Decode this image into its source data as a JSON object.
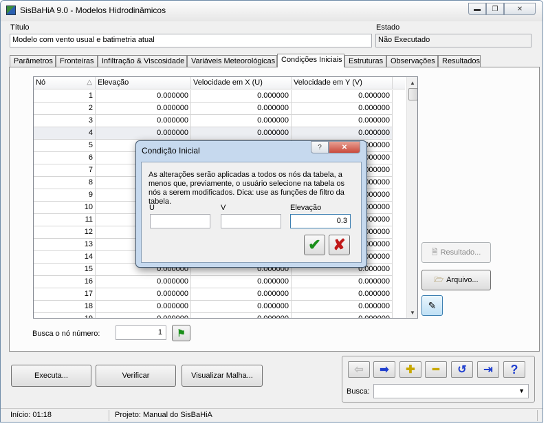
{
  "window": {
    "title": "SisBaHiA 9.0 - Modelos Hidrodinâmicos"
  },
  "colors": {
    "accent_blue": "#1f3fcf",
    "ok_green": "#1a8f1a",
    "cancel_red": "#c01818",
    "close_red": "#c94a3c"
  },
  "header": {
    "titulo_label": "Título",
    "titulo_value": "Modelo com vento usual e batimetria atual",
    "estado_label": "Estado",
    "estado_value": "Não Executado"
  },
  "tabs": [
    {
      "label": "Parâmetros"
    },
    {
      "label": "Fronteiras"
    },
    {
      "label": "Infiltração & Viscosidade"
    },
    {
      "label": "Variáveis Meteorológicas"
    },
    {
      "label": "Condições Iniciais",
      "active": true
    },
    {
      "label": "Estruturas"
    },
    {
      "label": "Observações"
    },
    {
      "label": "Resultados"
    }
  ],
  "grid": {
    "columns": [
      "Nó",
      "Elevação",
      "Velocidade em X (U)",
      "Velocidade em Y (V)"
    ],
    "sort_indicator": "△",
    "rows": [
      [
        "1",
        "0.000000",
        "0.000000",
        "0.000000"
      ],
      [
        "2",
        "0.000000",
        "0.000000",
        "0.000000"
      ],
      [
        "3",
        "0.000000",
        "0.000000",
        "0.000000"
      ],
      [
        "4",
        "0.000000",
        "0.000000",
        "0.000000"
      ],
      [
        "5",
        "0.000000",
        "0.000000",
        "0.000000"
      ],
      [
        "6",
        "0.000000",
        "0.000000",
        "0.000000"
      ],
      [
        "7",
        "0.000000",
        "0.000000",
        "0.000000"
      ],
      [
        "8",
        "0.000000",
        "0.000000",
        "0.000000"
      ],
      [
        "9",
        "0.000000",
        "0.000000",
        "0.000000"
      ],
      [
        "10",
        "0.000000",
        "0.000000",
        "0.000000"
      ],
      [
        "11",
        "0.000000",
        "0.000000",
        "0.000000"
      ],
      [
        "12",
        "0.000000",
        "0.000000",
        "0.000000"
      ],
      [
        "13",
        "0.000000",
        "0.000000",
        "0.000000"
      ],
      [
        "14",
        "0.000000",
        "0.000000",
        "0.000000"
      ],
      [
        "15",
        "0.000000",
        "0.000000",
        "0.000000"
      ],
      [
        "16",
        "0.000000",
        "0.000000",
        "0.000000"
      ],
      [
        "17",
        "0.000000",
        "0.000000",
        "0.000000"
      ],
      [
        "18",
        "0.000000",
        "0.000000",
        "0.000000"
      ],
      [
        "19",
        "0.000000",
        "0.000000",
        "0.000000"
      ]
    ]
  },
  "side_buttons": {
    "resultado": "Resultado...",
    "arquivo": "Arquivo..."
  },
  "search_node": {
    "label": "Busca o nó número:",
    "value": "1"
  },
  "actions": {
    "executa": "Executa...",
    "verificar": "Verificar",
    "visualizar": "Visualizar Malha..."
  },
  "nav": {
    "busca_label": "Busca:",
    "busca_value": "",
    "help": "?"
  },
  "status": {
    "inicio": "Início: 01:18",
    "projeto": "Projeto: Manual do SisBaHiA"
  },
  "dialog": {
    "title": "Condição Inicial",
    "help": "?",
    "message": "As alterações serão aplicadas a todos os nós da tabela, a menos que, previamente, o usuário selecione na tabela os nós a serem modificados. Dica: use as funções de filtro da tabela.",
    "u_label": "U",
    "u_value": "",
    "v_label": "V",
    "v_value": "",
    "elev_label": "Elevação",
    "elev_value": "0.3"
  }
}
